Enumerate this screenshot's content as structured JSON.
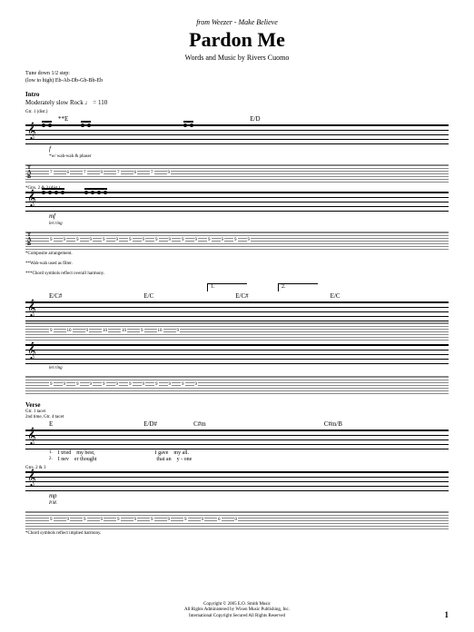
{
  "header": {
    "source_prefix": "from Weezer - ",
    "source_album": "Make Believe",
    "title": "Pardon Me",
    "credits": "Words and Music by Rivers Cuomo"
  },
  "tuning": {
    "line1": "Tune down 1/2 step:",
    "line2": "(low to high) Eb-Ab-Db-Gb-Bb-Eb"
  },
  "sections": {
    "intro": "Intro",
    "tempo": "Moderately slow Rock ♩ = 110",
    "verse": "Verse"
  },
  "guitars": {
    "g1": "Gtr. 1 (dist.)",
    "g2": "*Gtrs. 2 & 3 (dist.)",
    "g1_tacet": "Gtr. 1 tacet",
    "g23_cont": "2nd time, Gtr. 4 tacet",
    "g23": "Gtrs. 2 & 3"
  },
  "chords": {
    "s1": {
      "c1": "**E",
      "c2": "E/D"
    },
    "s2": {
      "c1": "E/C#",
      "c2": "E/C",
      "c3": "E/C#",
      "c4": "E/C"
    },
    "s3": {
      "c1": "E",
      "c2": "E/D#",
      "c3": "C#m",
      "c4": "C#m/B"
    }
  },
  "dynamics": {
    "f": "f",
    "mf": "mf",
    "mp": "mp"
  },
  "instructions": {
    "phaser": "*w/ wah-wah & phaser",
    "letring": "let ring",
    "pm": "P.M."
  },
  "tab_nums": {
    "s1a": [
      "7",
      "6",
      "7",
      "9",
      "7",
      "6",
      "7",
      "9"
    ],
    "s1b": [
      "9",
      "9",
      "9",
      "9",
      "9",
      "9",
      "9",
      "9",
      "9",
      "9",
      "9",
      "9",
      "9",
      "9",
      "9",
      "9"
    ],
    "s2a": [
      "9",
      "10",
      "9",
      "10",
      "10",
      "9",
      "10",
      "9",
      "10",
      "10",
      "9",
      "9"
    ],
    "s2b": [
      "9",
      "9",
      "9",
      "9",
      "9",
      "9",
      "9",
      "9",
      "9",
      "9",
      "9",
      "9",
      "9",
      "9",
      "9",
      "9"
    ],
    "s3": [
      "9",
      "9",
      "9",
      "9",
      "9",
      "9",
      "9",
      "9",
      "9",
      "9",
      "0",
      "0"
    ]
  },
  "voltas": {
    "v1": "1.",
    "v2": "2."
  },
  "lyrics": {
    "l1_num": "1.",
    "l1a": "I tried",
    "l1b": "my best,",
    "l1c": "I gave",
    "l1d": "my all.",
    "l2_num": "2.",
    "l2a": "I nev",
    "l2b": "er thought",
    "l2c": "that an",
    "l2d": "y - one"
  },
  "footnotes": {
    "f1": "*Composite arrangement.",
    "f2": "**Wah-wah used as filter.",
    "f3": "***Chord symbols reflect overall harmony.",
    "f4": "*Chord symbols reflect implied harmony."
  },
  "copyright": {
    "line1": "Copyright © 2005 E.O. Smith Music",
    "line2": "All Rights Administered by Wixen Music Publishing, Inc.",
    "line3": "International Copyright Secured   All Rights Reserved"
  },
  "page_number": "1"
}
